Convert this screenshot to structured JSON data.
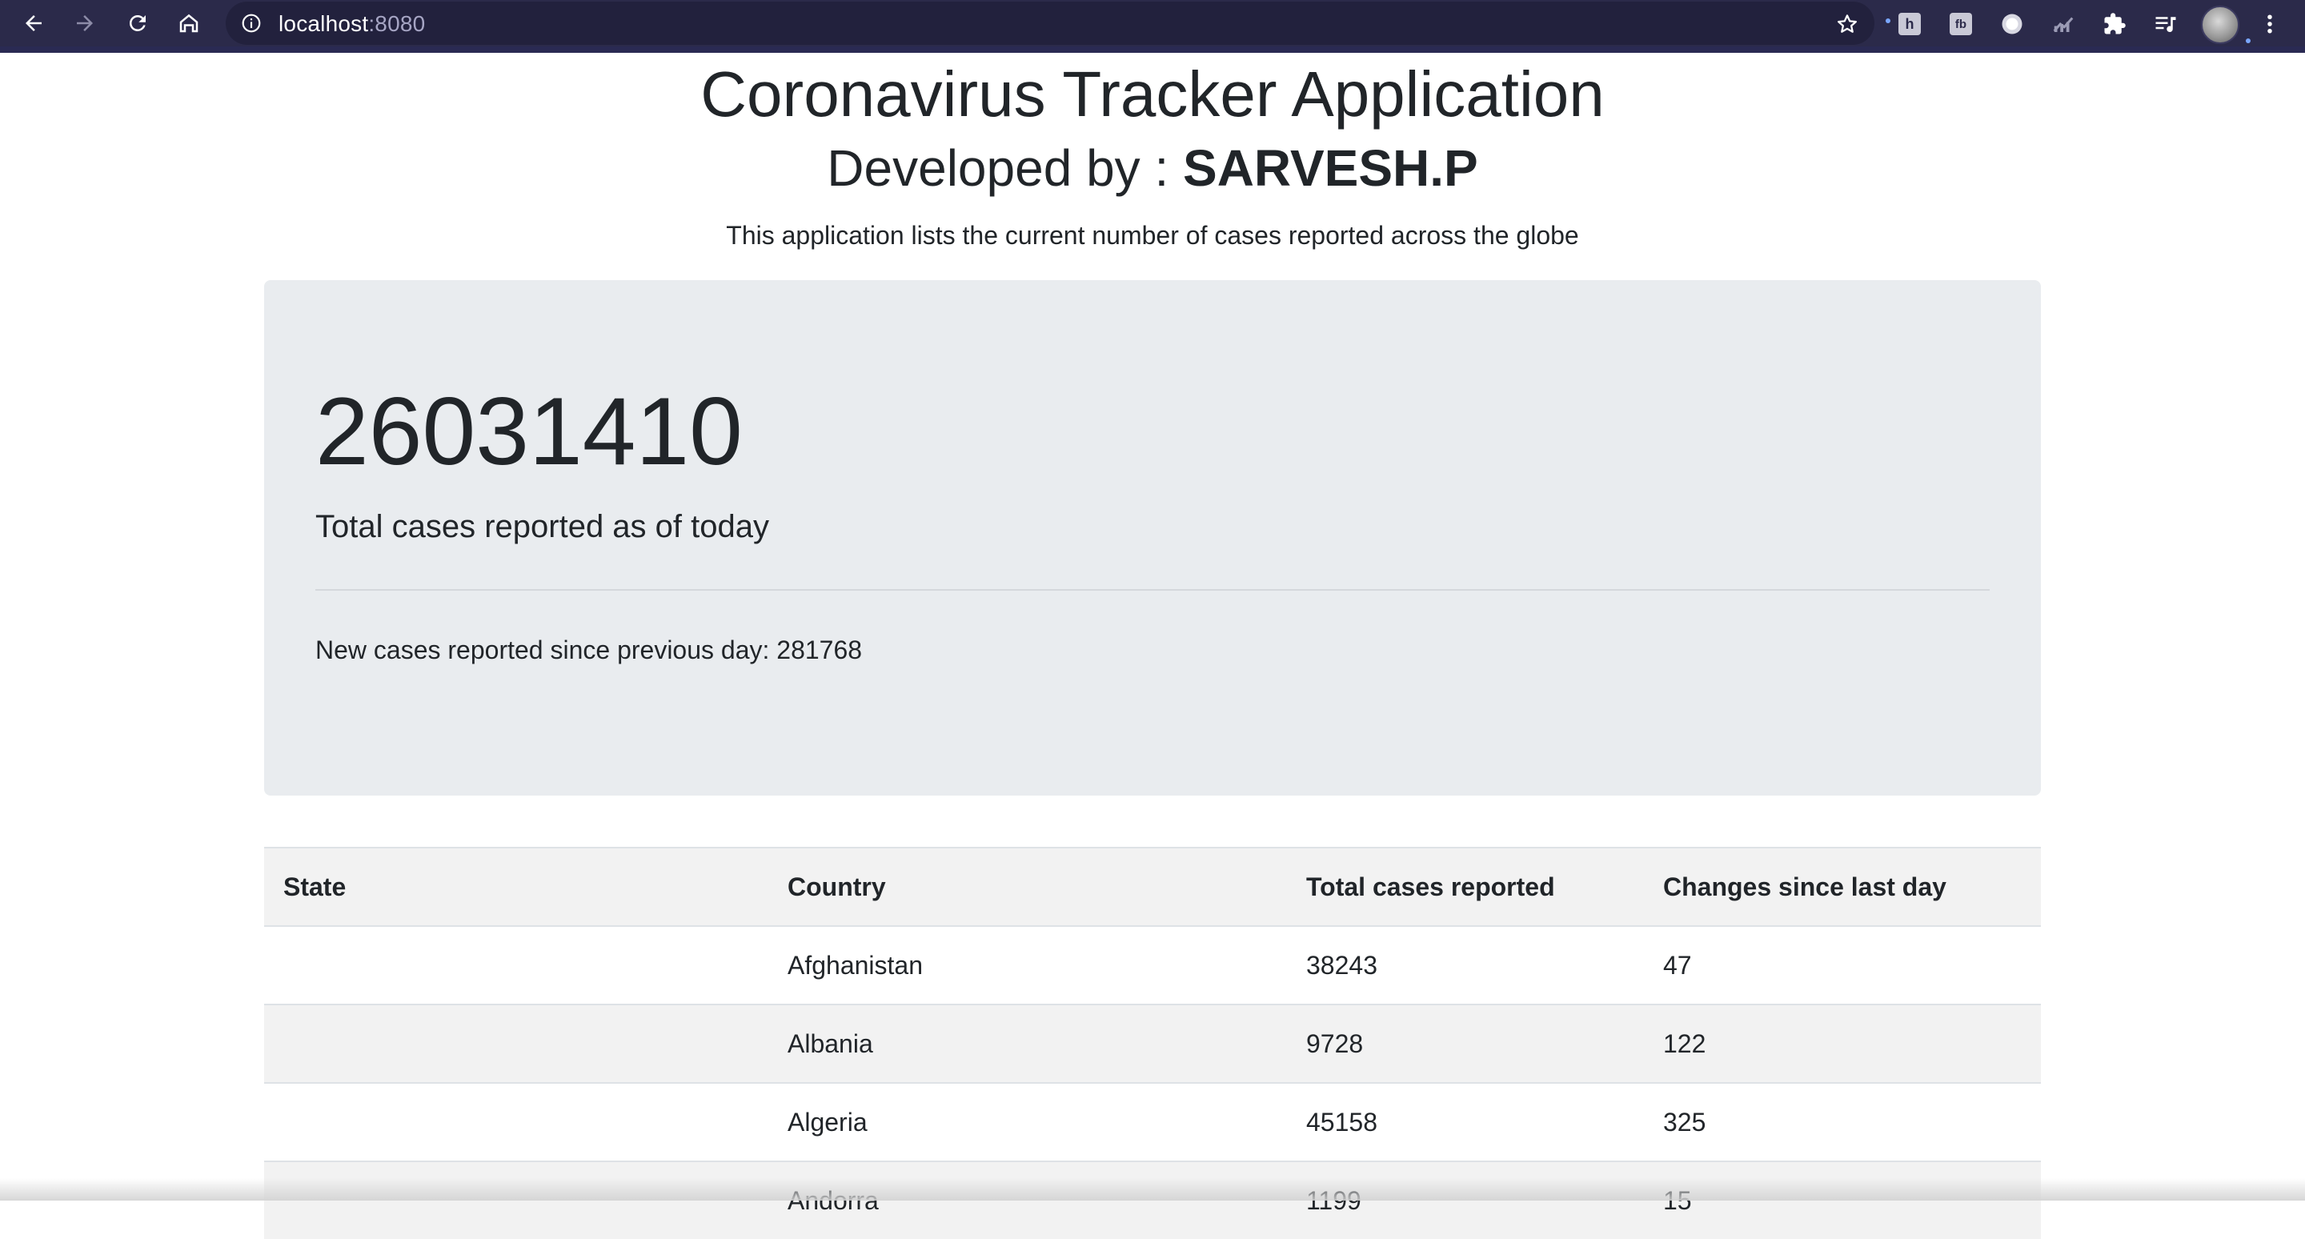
{
  "browser": {
    "url_host": "localhost",
    "url_port": ":8080",
    "icons": [
      "back-icon",
      "forward-icon",
      "reload-icon",
      "home-icon",
      "info-icon",
      "bookmark-star-icon",
      "extensions-puzzle-icon",
      "reading-list-icon",
      "menu-kebab-icon"
    ],
    "extensions": [
      "h",
      "fb"
    ],
    "accent_color": "#2b2a4a"
  },
  "header": {
    "title": "Coronavirus Tracker Application",
    "developed_by_label": "Developed by : ",
    "developer_name": "SARVESH.P",
    "lead": "This application lists the current number of cases reported across the globe"
  },
  "summary": {
    "total_cases": "26031410",
    "total_label": "Total cases reported as of today",
    "new_cases_text": "New cases reported since previous day: 281768"
  },
  "table": {
    "columns": [
      "State",
      "Country",
      "Total cases reported",
      "Changes since last day"
    ],
    "rows": [
      {
        "state": "",
        "country": "Afghanistan",
        "total": "38243",
        "change": "47"
      },
      {
        "state": "",
        "country": "Albania",
        "total": "9728",
        "change": "122"
      },
      {
        "state": "",
        "country": "Algeria",
        "total": "45158",
        "change": "325"
      },
      {
        "state": "",
        "country": "Andorra",
        "total": "1199",
        "change": "15"
      }
    ]
  }
}
